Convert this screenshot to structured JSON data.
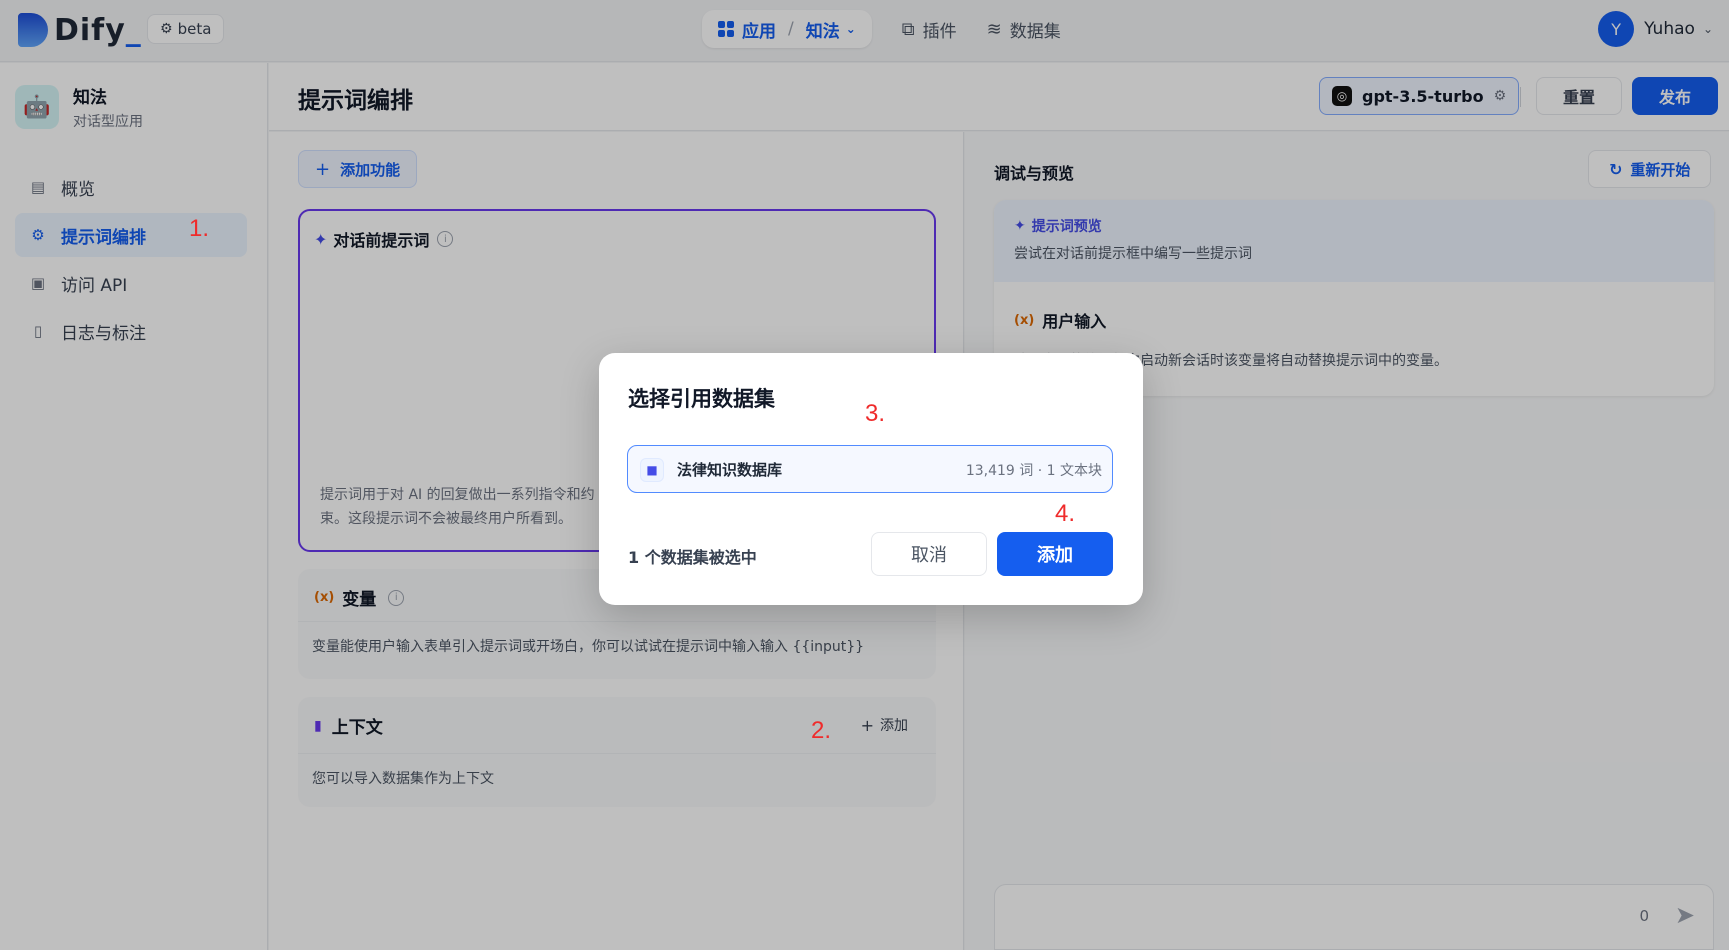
{
  "topnav": {
    "logo": "Dify",
    "beta": "beta",
    "apps_label": "应用",
    "app_current": "知法",
    "plugins_label": "插件",
    "datasets_label": "数据集",
    "user_initial": "Y",
    "user_name": "Yuhao"
  },
  "sidebar": {
    "app_name": "知法",
    "app_type": "对话型应用",
    "items": [
      {
        "label": "概览"
      },
      {
        "label": "提示词编排"
      },
      {
        "label": "访问 API"
      },
      {
        "label": "日志与标注"
      }
    ]
  },
  "header": {
    "title": "提示词编排",
    "model": "gpt-3.5-turbo",
    "reset": "重置",
    "publish": "发布"
  },
  "config": {
    "add_feature": "添加功能",
    "prompt_title": "对话前提示词",
    "prompt_hint": "提示词用于对 AI 的回复做出一系列指令和约束。这段提示词不会被最终用户所看到。",
    "variables_title": "变量",
    "variables_desc": "变量能使用户输入表单引入提示词或开场白，你可以试试在提示词中输入输入 {{input}}",
    "context_title": "上下文",
    "context_add": "添加",
    "context_desc": "您可以导入数据集作为上下文"
  },
  "debug": {
    "title": "调试与预览",
    "restart": "重新开始",
    "preview_title": "提示词预览",
    "preview_sub": "尝试在对话前提示框中编写一些提示词",
    "user_input_title": "用户输入",
    "user_input_desc": "填入变量的值，每次启动新会话时该变量将自动替换提示词中的变量。",
    "char_count": "0"
  },
  "modal": {
    "title": "选择引用数据集",
    "dataset_name": "法律知识数据库",
    "dataset_meta": "13,419 词 · 1 文本块",
    "selected": "1 个数据集被选中",
    "cancel": "取消",
    "add": "添加"
  },
  "annotations": [
    "1.",
    "2.",
    "3.",
    "4."
  ],
  "colors": {
    "primary": "#155eef",
    "prompt_border": "#6938ef",
    "annotation": "#ef2b2b"
  }
}
